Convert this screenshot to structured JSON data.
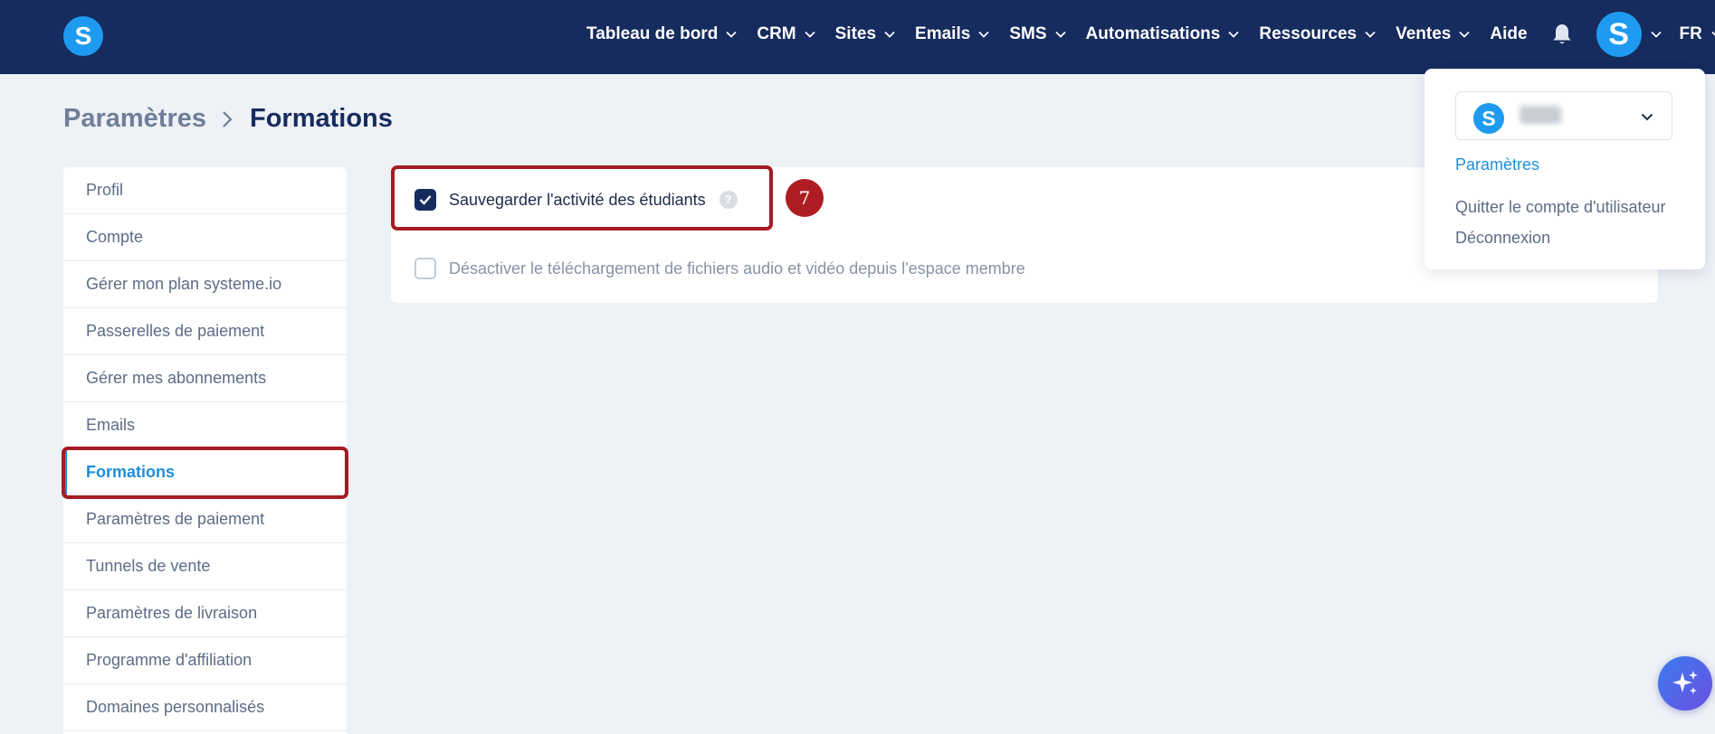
{
  "app": {
    "logo_letter": "S"
  },
  "nav": {
    "items": [
      {
        "label": "Tableau de bord"
      },
      {
        "label": "CRM"
      },
      {
        "label": "Sites"
      },
      {
        "label": "Emails"
      },
      {
        "label": "SMS"
      },
      {
        "label": "Automatisations"
      },
      {
        "label": "Ressources"
      },
      {
        "label": "Ventes"
      }
    ],
    "help_label": "Aide",
    "avatar_letter": "S",
    "language": "FR"
  },
  "breadcrumb": {
    "parent": "Paramètres",
    "current": "Formations"
  },
  "sidebar": {
    "items": [
      {
        "label": "Profil"
      },
      {
        "label": "Compte"
      },
      {
        "label": "Gérer mon plan systeme.io"
      },
      {
        "label": "Passerelles de paiement"
      },
      {
        "label": "Gérer mes abonnements"
      },
      {
        "label": "Emails"
      },
      {
        "label": "Formations"
      },
      {
        "label": "Paramètres de paiement"
      },
      {
        "label": "Tunnels de vente"
      },
      {
        "label": "Paramètres de livraison"
      },
      {
        "label": "Programme d'affiliation"
      },
      {
        "label": "Domaines personnalisés"
      }
    ],
    "active_index": 6
  },
  "settings": {
    "save_activity": {
      "label": "Sauvegarder l'activité des étudiants",
      "checked": true,
      "help": "?"
    },
    "disable_download": {
      "label": "Désactiver le téléchargement de fichiers audio et vidéo depuis l'espace membre",
      "checked": false
    }
  },
  "annotation": {
    "step_number": "7",
    "color": "#a51c24"
  },
  "profile_menu": {
    "account_logo_letter": "S",
    "items": [
      {
        "label": "Paramètres"
      },
      {
        "label": "Quitter le compte d'utilisateur"
      },
      {
        "label": "Déconnexion"
      }
    ]
  },
  "colors": {
    "topbar": "#162b5e",
    "brand_blue": "#1e9bf0",
    "link_active": "#1e8fdc",
    "page_bg": "#eef1f6"
  },
  "icons": {
    "nav_chevrons": "chevron-down-icon",
    "bell": "bell-icon",
    "breadcrumb_separator": "chevron-right-icon",
    "checkbox_mark": "check-icon",
    "ai_assistant": "sparkles-icon"
  }
}
